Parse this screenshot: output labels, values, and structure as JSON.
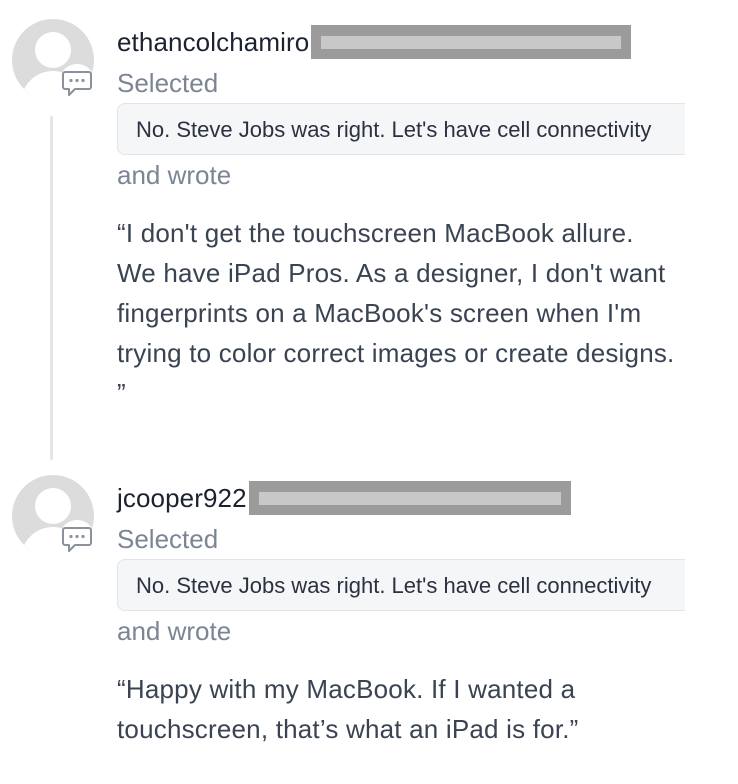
{
  "comments": [
    {
      "username": "ethancolchamiro",
      "selected_label": "Selected",
      "quoted_text": "No. Steve Jobs was right. Let's have cell connectivity",
      "wrote_label": "and wrote",
      "comment_text": "“I don't get the touchscreen MacBook allure. We have iPad Pros. As a designer, I don't want fingerprints on a MacBook's screen when I'm trying to color correct images or create designs. ”",
      "avatar_icon": "default-user-avatar-icon",
      "badge_icon": "chat-bubble-icon"
    },
    {
      "username": "jcooper922",
      "selected_label": "Selected",
      "quoted_text": "No. Steve Jobs was right. Let's have cell connectivity",
      "wrote_label": "and wrote",
      "comment_text": "“Happy with my MacBook. If I wanted a touchscreen, that’s what an iPad is for.”",
      "avatar_icon": "default-user-avatar-icon",
      "badge_icon": "chat-bubble-icon"
    }
  ],
  "colors": {
    "text_primary": "#1b2331",
    "text_muted": "#7c8594",
    "quote_bg": "#f5f6f7",
    "avatar_bg": "#dcdcdc",
    "redaction": "#9b9b9b",
    "thread_line": "#e3e5e8"
  }
}
